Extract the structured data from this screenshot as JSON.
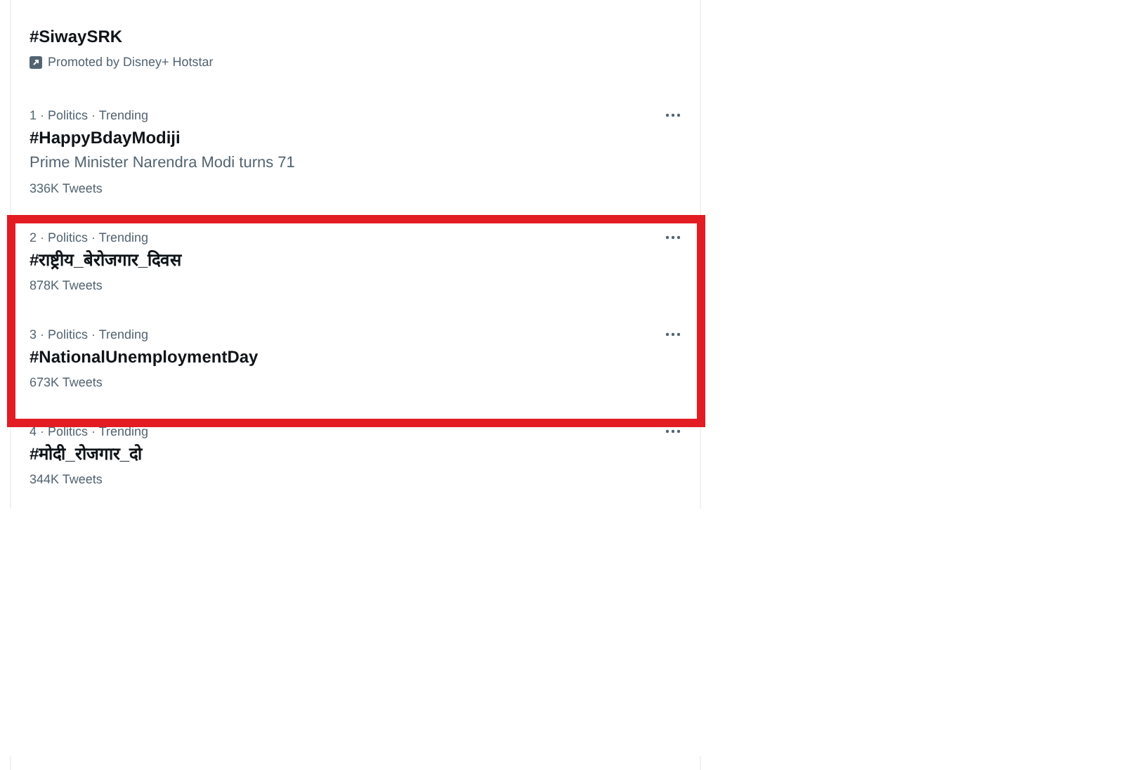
{
  "promoted": {
    "title": "#SiwaySRK",
    "promoter": "Promoted by Disney+ Hotstar"
  },
  "trends": [
    {
      "meta": "1 · Politics · Trending",
      "title": "#HappyBdayModiji",
      "description": "Prime Minister Narendra Modi turns 71",
      "count": "336K Tweets",
      "highlighted": false
    },
    {
      "meta": "2 · Politics · Trending",
      "title": "#राष्ट्रीय_बेरोजगार_दिवस",
      "count": "878K Tweets",
      "highlighted": true
    },
    {
      "meta": "3 · Politics · Trending",
      "title": "#NationalUnemploymentDay",
      "count": "673K Tweets",
      "highlighted": true
    },
    {
      "meta": "4 · Politics · Trending",
      "title": "#मोदी_रोजगार_दो",
      "count": "344K Tweets",
      "highlighted": false
    }
  ]
}
